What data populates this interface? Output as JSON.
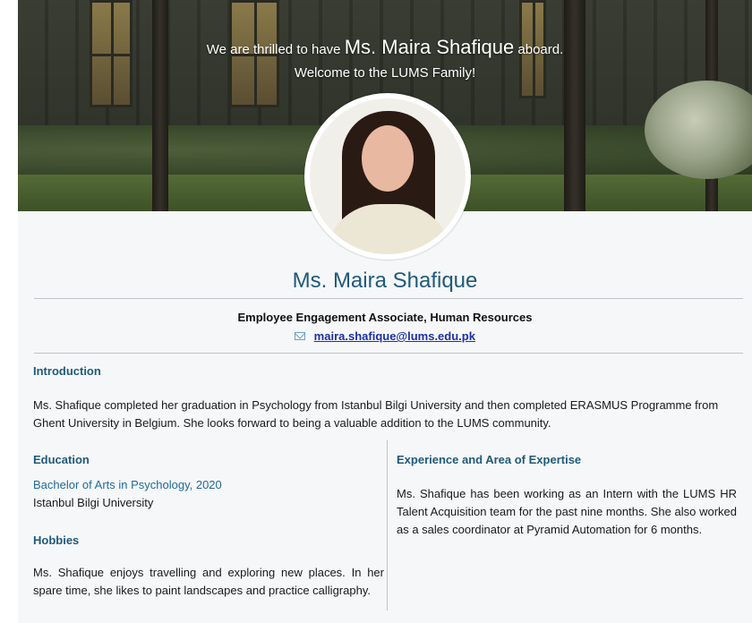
{
  "banner": {
    "welcome_prefix": "We are thrilled to have",
    "welcome_name": "Ms. Maira Shafique",
    "welcome_suffix": "aboard.",
    "welcome_line2": "Welcome to the LUMS Family!"
  },
  "profile": {
    "name": "Ms. Maira Shafique",
    "role": "Employee Engagement Associate, Human Resources",
    "email": "maira.shafique@lums.edu.pk"
  },
  "introduction": {
    "heading": "Introduction",
    "text": "Ms. Shafique completed her graduation in Psychology from Istanbul Bilgi University and then completed ERASMUS Programme from Ghent University in Belgium. She looks forward to being a valuable addition to the LUMS community."
  },
  "education": {
    "heading": "Education",
    "degree": "Bachelor of Arts in Psychology, 2020",
    "institution": "Istanbul Bilgi University"
  },
  "hobbies": {
    "heading": "Hobbies",
    "text": "Ms. Shafique enjoys travelling and exploring new places. In her spare time, she likes to paint landscapes and practice calligraphy."
  },
  "experience": {
    "heading": "Experience and Area of Expertise",
    "text": "Ms. Shafique has been working as an Intern with the LUMS HR Talent Acquisition team for the past nine months. She also worked as a sales coordinator at Pyramid Automation for 6 months."
  },
  "colors": {
    "heading": "#1f5a7a",
    "link": "#1c2fa8",
    "degree": "#1f6a9a"
  },
  "icons": [
    "mail-icon"
  ]
}
